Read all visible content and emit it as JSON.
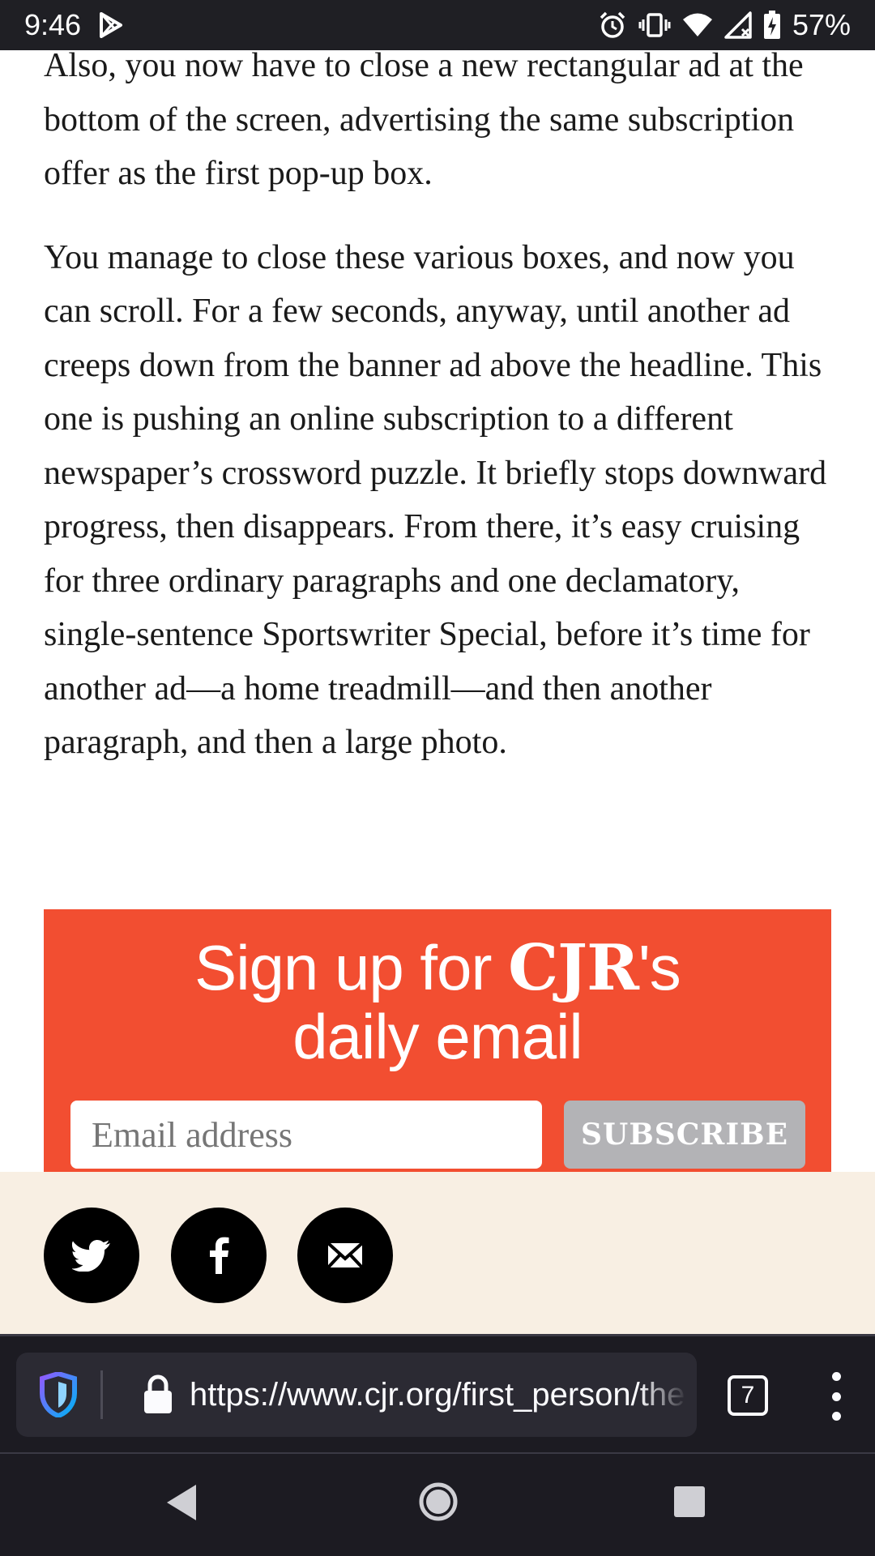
{
  "status_bar": {
    "time": "9:46",
    "battery": "57%",
    "icons": [
      "play-store-icon",
      "alarm-icon",
      "vibrate-icon",
      "wifi-icon",
      "cell-signal-icon",
      "battery-charging-icon"
    ]
  },
  "article": {
    "paragraph_1": "Also, you now have to close a new rectangular ad at the bottom of the screen, advertising the same subscription offer as the first pop-up box.",
    "paragraph_2": "You manage to close these various boxes, and now you can scroll. For a few seconds, anyway, until another ad creeps down from the banner ad above the headline. This one is pushing an online subscription to a different newspaper’s crossword puzzle. It briefly stops downward progress, then disappears. From there, it’s easy cruising for three ordinary paragraphs and one declamatory, single-sentence Sportswriter Special, before it’s time for another ad—a home treadmill—and then another paragraph, and then a large photo."
  },
  "signup": {
    "title_before": "Sign up for ",
    "title_brand": "CJR",
    "title_after": "'s",
    "title_line2": "daily email",
    "email_placeholder": "Email address",
    "subscribe_label": "SUBSCRIBE",
    "background_color": "#f24e31",
    "button_color": "#b3b3b6"
  },
  "share": {
    "buttons": [
      "twitter-icon",
      "facebook-icon",
      "email-icon"
    ],
    "background_color": "#f8efe3"
  },
  "browser": {
    "url": "https://www.cjr.org/first_person/the",
    "tab_count": "7"
  },
  "nav": {
    "buttons": [
      "back-icon",
      "home-icon",
      "recents-icon"
    ]
  }
}
